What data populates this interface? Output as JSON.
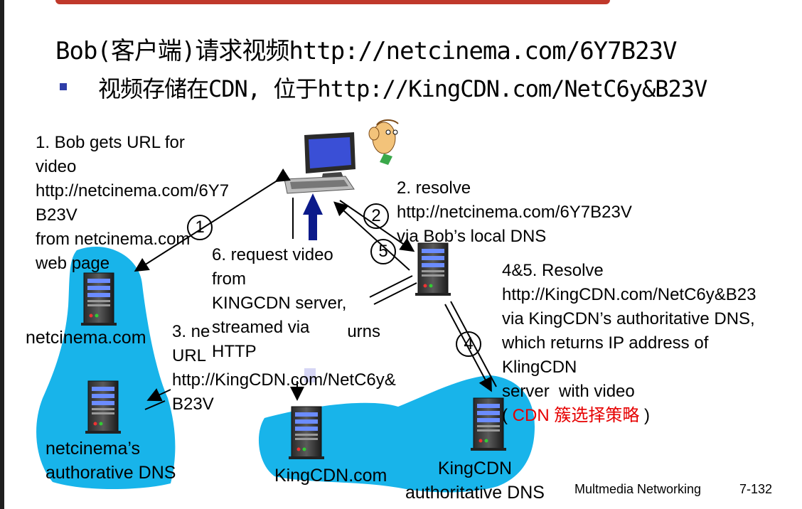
{
  "slide": {
    "title": "Bob(客户端)请求视频http://netcinema.com/6Y7B23V",
    "bullet": "视频存储在CDN, 位于http://KingCDN.com/NetC6y&B23V",
    "footer_left": "Multmedia Networking",
    "footer_right": "7-132"
  },
  "steps": {
    "s1": "1. Bob gets URL for\nvideo\nhttp://netcinema.com/6Y7\nB23V\nfrom netcinema.com\nweb page",
    "s2": "2. resolve\nhttp://netcinema.com/6Y7B23V\nvia Bob’s local DNS",
    "s3": "3. netcinema’s DNS returns\nURL\nhttp://KingCDN.com/NetC6y&\nB23V",
    "s45": "4&5. Resolve\nhttp://KingCDN.com/NetC6y&B23\nvia KingCDN’s authoritative DNS,\nwhich returns IP address of\nKlingCDN\nserver  with video\n(",
    "s45_red": "CDN 簇选择策略",
    "s45_close": ")",
    "s6": "6. request video\nfrom\nKINGCDN server,\nstreamed via\nHTTP"
  },
  "circles": {
    "c1": "1",
    "c2": "2",
    "c4": "4",
    "c5": "5"
  },
  "nodes": {
    "netcinema": "netcinema.com",
    "netcinema_dns": "netcinema’s\nauthorative DNS",
    "kingcdn": "KingCDN.com",
    "kingcdn_dns": "KingCDN\nauthoritative DNS"
  },
  "colors": {
    "blob": "#18b4ea",
    "accent_arrow": "#0b1a8a",
    "red_text": "#e60000"
  }
}
